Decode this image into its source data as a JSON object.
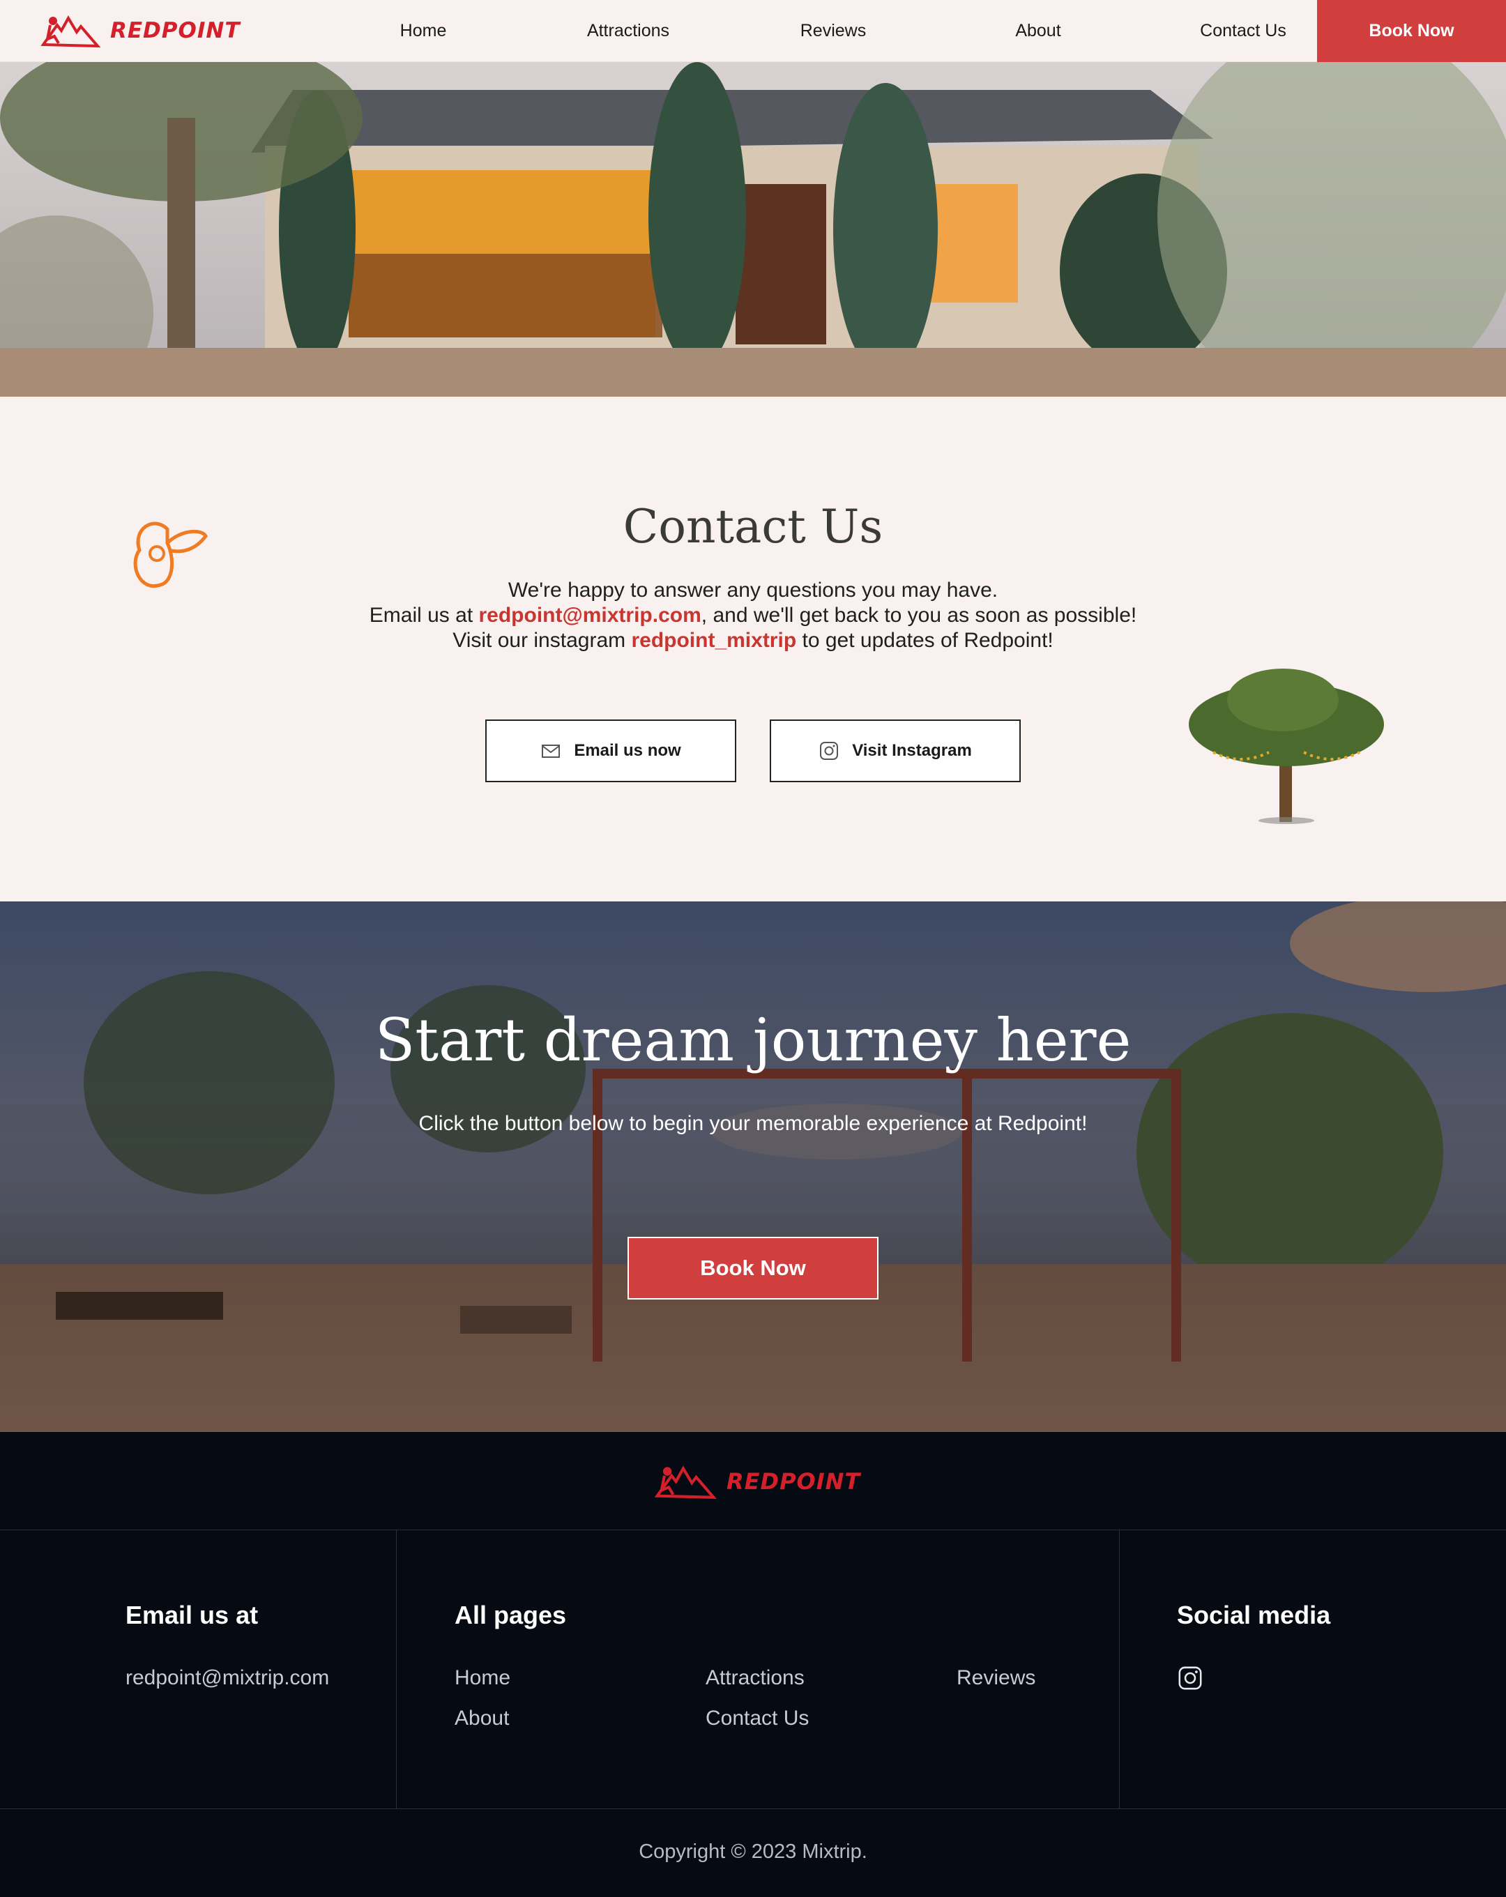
{
  "brand": {
    "name": "REDPOINT",
    "accent": "#d13e3e",
    "logo_red": "#d3202a"
  },
  "nav": {
    "links": [
      "Home",
      "Attractions",
      "Reviews",
      "About",
      "Contact Us"
    ],
    "cta": "Book Now"
  },
  "contact": {
    "title": "Contact Us",
    "line1": "We're happy to answer any questions you may have.",
    "line2_pre": "Email us at ",
    "email": "redpoint@mixtrip.com",
    "line2_post": ", and we'll get back to you as soon as possible!",
    "line3_pre": "Visit our instagram ",
    "instagram": "redpoint_mixtrip",
    "line3_post": " to get updates of Redpoint!",
    "email_button": "Email us now",
    "instagram_button": "Visit Instagram"
  },
  "cta": {
    "title": "Start dream journey here",
    "subtitle": "Click the button below to begin your memorable experience at Redpoint!",
    "button": "Book Now"
  },
  "footer": {
    "email_heading": "Email us at",
    "email": "redpoint@mixtrip.com",
    "pages_heading": "All pages",
    "pages": [
      "Home",
      "Attractions",
      "Reviews",
      "About",
      "Contact Us"
    ],
    "social_heading": "Social media",
    "copyright": "Copyright © 2023 Mixtrip."
  },
  "icons": [
    "redpoint-logo-icon",
    "mail-icon",
    "instagram-icon",
    "butterfly-icon",
    "tree-icon"
  ]
}
